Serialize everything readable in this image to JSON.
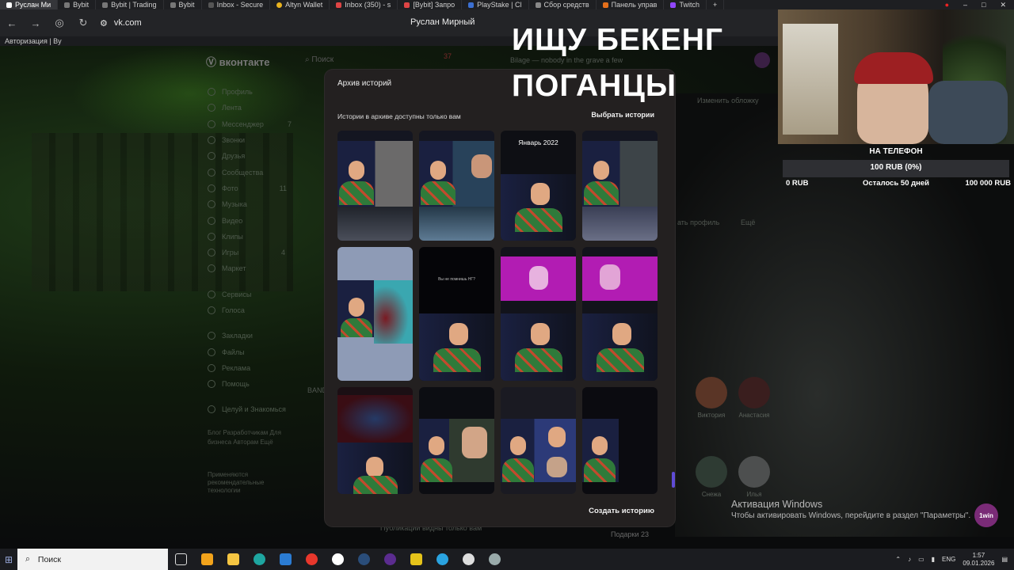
{
  "browser": {
    "tabs": [
      {
        "label": "Руслан Ми"
      },
      {
        "label": "Bybit"
      },
      {
        "label": "Bybit | Trading"
      },
      {
        "label": "Bybit"
      },
      {
        "label": "Inbox - Secure"
      },
      {
        "label": "Altyn Wallet"
      },
      {
        "label": "Inbox (350) - s"
      },
      {
        "label": "[Bybit] Запро"
      },
      {
        "label": "PlayStake | Cl"
      },
      {
        "label": "Сбор средств"
      },
      {
        "label": "Панель управ"
      },
      {
        "label": "Twitch"
      }
    ],
    "url": "vk.com",
    "profile_name": "Руслан Мирный",
    "bookmark": "Авторизация | By"
  },
  "vk": {
    "logo": "вконтакте",
    "search_placeholder": "Поиск",
    "notif_count": "37",
    "now_playing": "Bilage — nobody in the grave a few",
    "sidebar": [
      "Профиль",
      "Лента",
      "Мессенджер",
      "Звонки",
      "Друзья",
      "Сообщества",
      "Фото",
      "Музыка",
      "Видео",
      "Клипы",
      "Игры",
      "Маркет",
      "Сервисы",
      "Голоса",
      "Закладки",
      "Файлы",
      "Реклама",
      "Помощь",
      "Целуй и Знакомься"
    ],
    "sidebar_counts": {
      "messenger": "7",
      "photo": "11",
      "games": "4"
    },
    "footer_links": "Блог  Разработчикам  Для бизнеса  Авторам  Ещё",
    "footer_note": "Применяются рекомендательные технологии",
    "edit_cover": "Изменить обложку",
    "edit_profile": "ать профиль",
    "more": "Ещё",
    "friends": [
      {
        "name": "Виктория"
      },
      {
        "name": "Анастасия"
      },
      {
        "name": "Снежа"
      },
      {
        "name": "Илья"
      }
    ],
    "archive_hint": "Публикации видны только вам",
    "gifts": "Подарки 23",
    "band": "BAND"
  },
  "modal": {
    "title": "Архив историй",
    "subtitle": "Истории в архиве доступны только вам",
    "select_button": "Выбрать истории",
    "month_label": "Январь 2022",
    "story_text": "Вы не помнишь НГ?",
    "create_button": "Создать историю"
  },
  "stream": {
    "overlay_line1": "ИЩУ БЕКЕНГ",
    "overlay_line2": "ПОГАНЦЫ",
    "goal_title": "НА ТЕЛЕФОН",
    "goal_value": "100 RUB (0%)",
    "goal_min": "0 RUB",
    "goal_remaining": "Осталось 50 дней",
    "goal_max": "100 000 RUB",
    "goal_progress": 0,
    "badge": "1win"
  },
  "windows": {
    "activate_title": "Активация Windows",
    "activate_sub": "Чтобы активировать Windows, перейдите в раздел \"Параметры\".",
    "search_placeholder": "Поиск",
    "lang": "ENG",
    "time": "1:57",
    "date": "09.01.2026"
  }
}
